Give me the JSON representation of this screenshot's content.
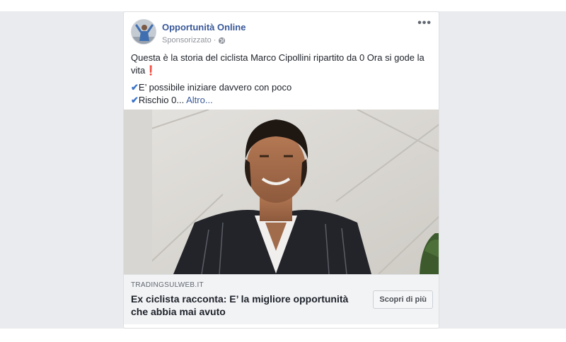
{
  "post": {
    "page_name": "Opportunità Online",
    "sponsored_label": "Sponsorizzato",
    "meta_separator": "·",
    "more_options": "•••",
    "text_line1": "Questa è la storia del ciclista Marco Cipollini ripartito da 0 Ora si gode la vita",
    "exclamation": "❗",
    "bullets": [
      {
        "check": "✔",
        "text": "E’ possibile iniziare davvero con poco"
      },
      {
        "check": "✔",
        "text": "Rischio 0... "
      }
    ],
    "more_link": "Altro...",
    "icons": {
      "avatar": "avatar-image",
      "globe": "globe-icon",
      "more": "more-options-icon",
      "check": "check-icon"
    }
  },
  "link_preview": {
    "domain": "TRADINGSULWEB.IT",
    "headline": "Ex ciclista racconta: E’ la migliore opportunità che abbia mai avuto",
    "cta_label": "Scopri di più"
  },
  "colors": {
    "link": "#385898",
    "check": "#3b73c7",
    "background": "#e9ebee"
  }
}
